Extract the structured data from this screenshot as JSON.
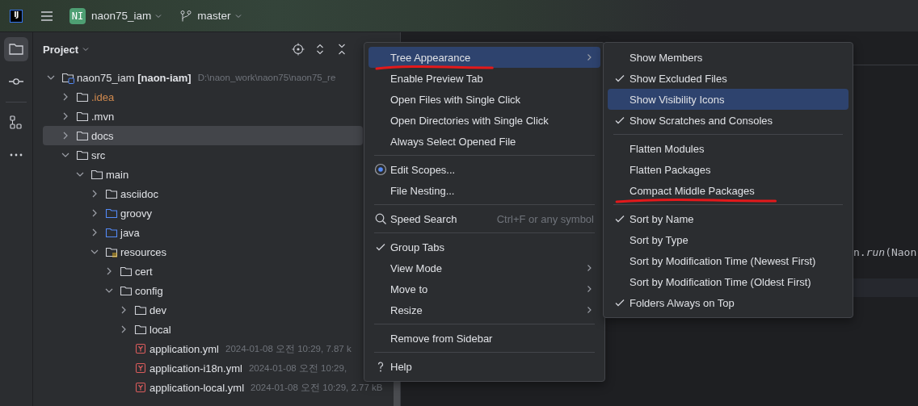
{
  "topbar": {
    "logo": "IJ",
    "project_badge": "NI",
    "project": "naon75_iam",
    "branch": "master"
  },
  "toolstrip": [
    {
      "kind": "project",
      "selected": true
    },
    {
      "kind": "commit",
      "selected": false
    },
    {
      "kind": "separator"
    },
    {
      "kind": "structure",
      "selected": false
    },
    {
      "kind": "more",
      "selected": false
    }
  ],
  "panel": {
    "title": "Project",
    "tree": [
      {
        "label": "naon75_iam **[naon-iam]**",
        "kind": "module",
        "expanded": true,
        "selected": false,
        "meta": "D:\\naon_work\\naon75\\naon75_re",
        "children": [
          {
            "label": ".idea",
            "kind": "folder",
            "expanded": false,
            "selected": false,
            "excluded": true
          },
          {
            "label": ".mvn",
            "kind": "folder",
            "expanded": false,
            "selected": false,
            "excluded": false
          },
          {
            "label": "docs",
            "kind": "folder",
            "expanded": false,
            "selected": true,
            "excluded": false
          },
          {
            "label": "src",
            "kind": "folder",
            "expanded": true,
            "selected": false,
            "excluded": false,
            "children": [
              {
                "label": "main",
                "kind": "folder",
                "expanded": true,
                "selected": false,
                "excluded": false,
                "children": [
                  {
                    "label": "asciidoc",
                    "kind": "folder",
                    "expanded": false,
                    "selected": false,
                    "excluded": false
                  },
                  {
                    "label": "groovy",
                    "kind": "source-folder",
                    "expanded": false,
                    "selected": false,
                    "excluded": false
                  },
                  {
                    "label": "java",
                    "kind": "source-folder",
                    "expanded": false,
                    "selected": false,
                    "excluded": false
                  },
                  {
                    "label": "resources",
                    "kind": "resource-folder",
                    "expanded": true,
                    "selected": false,
                    "excluded": false,
                    "children": [
                      {
                        "label": "cert",
                        "kind": "folder",
                        "expanded": false,
                        "selected": false,
                        "excluded": false
                      },
                      {
                        "label": "config",
                        "kind": "folder",
                        "expanded": true,
                        "selected": false,
                        "excluded": false,
                        "children": [
                          {
                            "label": "dev",
                            "kind": "folder",
                            "expanded": false,
                            "selected": false,
                            "excluded": false
                          },
                          {
                            "label": "local",
                            "kind": "folder",
                            "expanded": false,
                            "selected": false,
                            "excluded": false
                          },
                          {
                            "label": "application.yml",
                            "kind": "yaml",
                            "selected": false,
                            "meta": "2024-01-08 오전 10:29, 7.87 k"
                          },
                          {
                            "label": "application-i18n.yml",
                            "kind": "yaml",
                            "selected": false,
                            "meta": "2024-01-08 오전 10:29,"
                          },
                          {
                            "label": "application-local.yml",
                            "kind": "yaml",
                            "selected": false,
                            "meta": "2024-01-08 오전 10:29, 2.77 kB"
                          }
                        ]
                      }
                    ]
                  }
                ]
              }
            ]
          }
        ]
      }
    ]
  },
  "editor": {
    "code": "n.*run*(Naon"
  },
  "menu": [
    {
      "kind": "item",
      "label": "Tree Appearance",
      "submenu": true,
      "selected": true,
      "underlined": true
    },
    {
      "kind": "item",
      "label": "Enable Preview Tab",
      "submenu": false,
      "selected": false,
      "underlined": false
    },
    {
      "kind": "item",
      "label": "Open Files with Single Click",
      "submenu": false,
      "selected": false,
      "underlined": false
    },
    {
      "kind": "item",
      "label": "Open Directories with Single Click",
      "submenu": false,
      "selected": false,
      "underlined": false
    },
    {
      "kind": "item",
      "label": "Always Select Opened File",
      "submenu": false,
      "selected": false,
      "underlined": false
    },
    {
      "kind": "separator"
    },
    {
      "kind": "radio-item",
      "label": "Edit Scopes...",
      "submenu": false,
      "selected": false,
      "underlined": false
    },
    {
      "kind": "item",
      "label": "File Nesting...",
      "submenu": false,
      "selected": false,
      "underlined": false
    },
    {
      "kind": "separator"
    },
    {
      "kind": "search-item",
      "label": "Speed Search",
      "shortcut": "Ctrl+F or any symbol",
      "submenu": false,
      "selected": false,
      "underlined": false
    },
    {
      "kind": "separator"
    },
    {
      "kind": "item",
      "label": "Group Tabs",
      "submenu": false,
      "selected": false,
      "checked": true,
      "underlined": false
    },
    {
      "kind": "item",
      "label": "View Mode",
      "submenu": true,
      "selected": false,
      "underlined": false
    },
    {
      "kind": "item",
      "label": "Move to",
      "submenu": true,
      "selected": false,
      "underlined": false
    },
    {
      "kind": "item",
      "label": "Resize",
      "submenu": true,
      "selected": false,
      "underlined": false
    },
    {
      "kind": "separator"
    },
    {
      "kind": "item",
      "label": "Remove from Sidebar",
      "submenu": false,
      "selected": false,
      "underlined": false
    },
    {
      "kind": "separator"
    },
    {
      "kind": "help-item",
      "label": "Help",
      "submenu": false,
      "selected": false,
      "underlined": false
    }
  ],
  "submenu": [
    {
      "kind": "item",
      "label": "Show Members",
      "submenu": false,
      "selected": false,
      "checked": false,
      "underlined": false
    },
    {
      "kind": "item",
      "label": "Show Excluded Files",
      "submenu": false,
      "selected": false,
      "checked": true,
      "underlined": false
    },
    {
      "kind": "item",
      "label": "Show Visibility Icons",
      "submenu": false,
      "selected": true,
      "checked": false,
      "underlined": false
    },
    {
      "kind": "item",
      "label": "Show Scratches and Consoles",
      "submenu": false,
      "selected": false,
      "checked": true,
      "underlined": false
    },
    {
      "kind": "separator"
    },
    {
      "kind": "item",
      "label": "Flatten Modules",
      "submenu": false,
      "selected": false,
      "checked": false,
      "underlined": false
    },
    {
      "kind": "item",
      "label": "Flatten Packages",
      "submenu": false,
      "selected": false,
      "checked": false,
      "underlined": false
    },
    {
      "kind": "item",
      "label": "Compact Middle Packages",
      "submenu": false,
      "selected": false,
      "checked": false,
      "underlined": true
    },
    {
      "kind": "separator"
    },
    {
      "kind": "item",
      "label": "Sort by Name",
      "submenu": false,
      "selected": false,
      "checked": true,
      "underlined": false
    },
    {
      "kind": "item",
      "label": "Sort by Type",
      "submenu": false,
      "selected": false,
      "checked": false,
      "underlined": false
    },
    {
      "kind": "item",
      "label": "Sort by Modification Time (Newest First)",
      "submenu": false,
      "selected": false,
      "checked": false,
      "underlined": false
    },
    {
      "kind": "item",
      "label": "Sort by Modification Time (Oldest First)",
      "submenu": false,
      "selected": false,
      "checked": false,
      "underlined": false
    },
    {
      "kind": "item",
      "label": "Folders Always on Top",
      "submenu": false,
      "selected": false,
      "checked": true,
      "underlined": false
    }
  ]
}
